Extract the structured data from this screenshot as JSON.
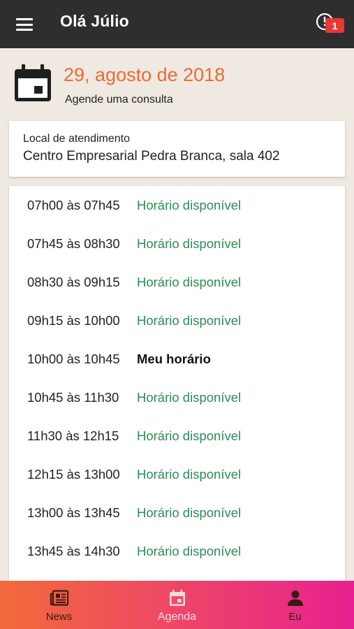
{
  "header": {
    "title": "Olá Júlio",
    "notification_count": "1"
  },
  "date_block": {
    "date": "29, agosto de 2018",
    "subtitle": "Agende uma consulta"
  },
  "location": {
    "label": "Local de atendimento",
    "value": "Centro Empresarial Pedra Branca, sala 402"
  },
  "schedule": {
    "slots": [
      {
        "time": "07h00 às 07h45",
        "status": "Horário disponível",
        "mine": false
      },
      {
        "time": "07h45 às 08h30",
        "status": "Horário disponível",
        "mine": false
      },
      {
        "time": "08h30 às 09h15",
        "status": "Horário disponível",
        "mine": false
      },
      {
        "time": "09h15 às 10h00",
        "status": "Horário disponível",
        "mine": false
      },
      {
        "time": "10h00 às 10h45",
        "status": "Meu horário",
        "mine": true
      },
      {
        "time": "10h45 às 11h30",
        "status": "Horário disponível",
        "mine": false
      },
      {
        "time": "11h30 às 12h15",
        "status": "Horário disponível",
        "mine": false
      },
      {
        "time": "12h15 às 13h00",
        "status": "Horário disponível",
        "mine": false
      },
      {
        "time": "13h00 às 13h45",
        "status": "Horário disponível",
        "mine": false
      },
      {
        "time": "13h45 às 14h30",
        "status": "Horário disponível",
        "mine": false
      }
    ]
  },
  "bottom_nav": {
    "items": [
      {
        "label": "News",
        "icon": "newspaper-icon",
        "active": false
      },
      {
        "label": "Agenda",
        "icon": "calendar-icon",
        "active": true
      },
      {
        "label": "Eu",
        "icon": "person-icon",
        "active": false
      }
    ]
  },
  "colors": {
    "appbar": "#2e2e2e",
    "date_accent": "#ee6a35",
    "available": "#2e8b57",
    "badge": "#e53935",
    "nav_gradient_start": "#f26a3a",
    "nav_gradient_end": "#e8208f"
  }
}
